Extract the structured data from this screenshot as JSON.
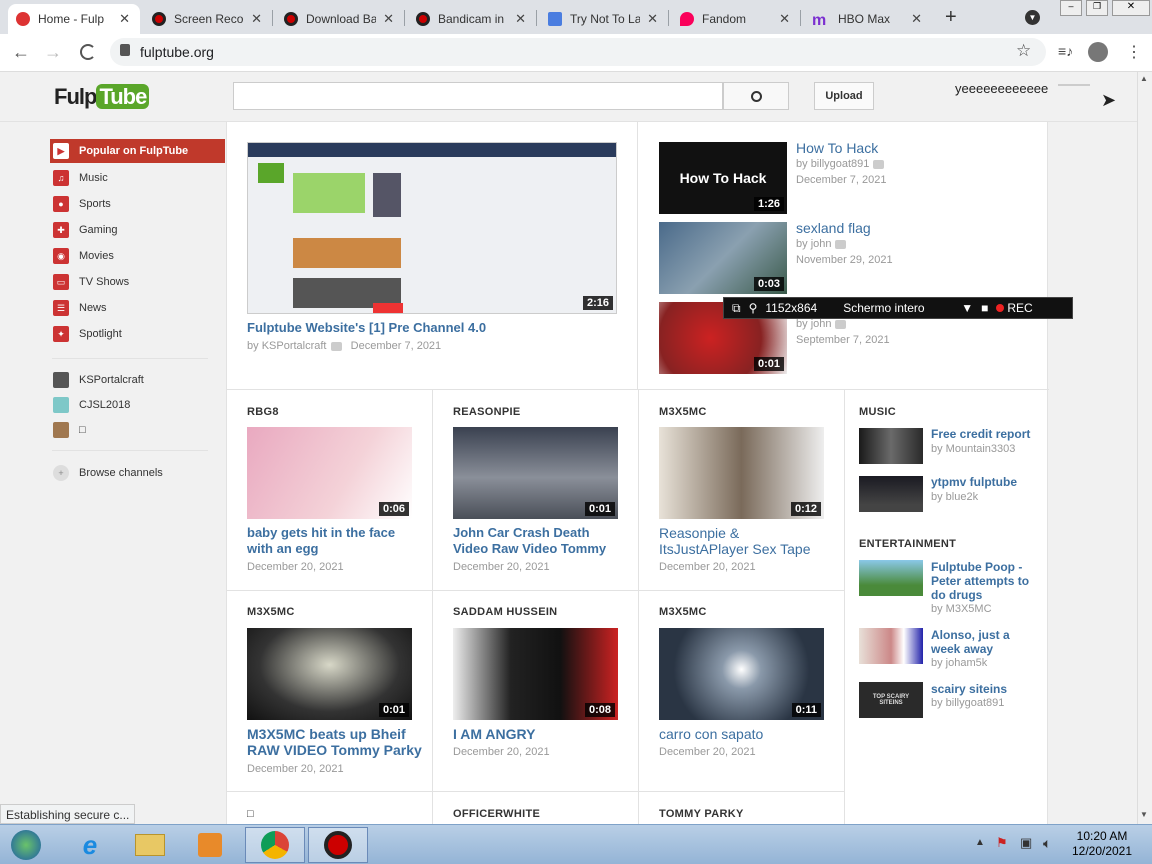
{
  "browser": {
    "tabs": [
      {
        "title": "Home - FulpTube",
        "active": true,
        "favicon_color": "#d33"
      },
      {
        "title": "Screen Recorder",
        "favicon_color": "#c00"
      },
      {
        "title": "Download Bandicam",
        "favicon_color": "#c00"
      },
      {
        "title": "Bandicam in",
        "favicon_color": "#c00"
      },
      {
        "title": "Try Not To Laugh",
        "favicon_color": "#4a7de0"
      },
      {
        "title": "Fandom",
        "favicon_color": "#fa005a"
      },
      {
        "title": "HBO Max",
        "favicon_color": "#7b2fd0"
      }
    ],
    "url": "fulptube.org",
    "status": "Establishing secure c..."
  },
  "site": {
    "logo_prefix": "Fulp",
    "logo_suffix": "Tube",
    "search_placeholder": "",
    "upload_label": "Upload",
    "username": "yeeeeeeeeeeee",
    "sidebar": {
      "categories": [
        {
          "label": "Popular on FulpTube",
          "icon": "youtube-icon",
          "active": true
        },
        {
          "label": "Music",
          "icon": "headphones-icon"
        },
        {
          "label": "Sports",
          "icon": "ball-icon"
        },
        {
          "label": "Gaming",
          "icon": "gamepad-icon"
        },
        {
          "label": "Movies",
          "icon": "film-icon"
        },
        {
          "label": "TV Shows",
          "icon": "tv-icon"
        },
        {
          "label": "News",
          "icon": "newspaper-icon"
        },
        {
          "label": "Spotlight",
          "icon": "spotlight-icon"
        }
      ],
      "subscriptions": [
        {
          "label": "KSPortalcraft"
        },
        {
          "label": "CJSL2018"
        },
        {
          "label": "□"
        }
      ],
      "browse_label": "Browse channels"
    },
    "featured": {
      "title": "Fulptube Website's [1] Pre Channel 4.0",
      "author": "KSPortalcraft",
      "date": "December 7, 2021",
      "duration": "2:16"
    },
    "side_videos": [
      {
        "title": "How To Hack",
        "author": "billygoat891",
        "date": "December 7, 2021",
        "duration": "1:26",
        "thumb_text": "How To Hack"
      },
      {
        "title": "sexland flag",
        "author": "john",
        "date": "November 29, 2021",
        "duration": "0:03"
      },
      {
        "title": "",
        "author": "john",
        "date": "September 7, 2021",
        "duration": "0:01"
      }
    ],
    "rows": [
      [
        {
          "channel": "RBG8",
          "title": "baby gets hit in the face with an egg",
          "date": "December 20, 2021",
          "duration": "0:06"
        },
        {
          "channel": "REASONPIE",
          "title": "John Car Crash Death Video Raw Video Tommy",
          "date": "December 20, 2021",
          "duration": "0:01"
        },
        {
          "channel": "M3X5MC",
          "title": "Reasonpie & ItsJustAPlayer Sex Tape",
          "date": "December 20, 2021",
          "duration": "0:12"
        }
      ],
      [
        {
          "channel": "M3X5MC",
          "title": "M3X5MC beats up Bheif RAW VIDEO Tommy Parky",
          "date": "December 20, 2021",
          "duration": "0:01"
        },
        {
          "channel": "SADDAM HUSSEIN",
          "title": "I AM ANGRY",
          "date": "December 20, 2021",
          "duration": "0:08"
        },
        {
          "channel": "M3X5MC",
          "title": "carro con sapato",
          "date": "December 20, 2021",
          "duration": "0:11"
        }
      ],
      [
        {
          "channel": "□"
        },
        {
          "channel": "OFFICERWHITE"
        },
        {
          "channel": "TOMMY PARKY"
        }
      ]
    ],
    "music": {
      "heading": "MUSIC",
      "items": [
        {
          "title": "Free credit report",
          "author": "by Mountain3303"
        },
        {
          "title": "ytpmv fulptube",
          "author": "by blue2k"
        }
      ]
    },
    "entertainment": {
      "heading": "ENTERTAINMENT",
      "items": [
        {
          "title": "Fulptube Poop - Peter attempts to do drugs",
          "author": "by M3X5MC"
        },
        {
          "title": "Alonso, just a week away",
          "author": "by joham5k"
        },
        {
          "title": "scairy siteins",
          "author": "by billygoat891",
          "thumb_text": "TOP SCAIRY SITEINS"
        }
      ]
    }
  },
  "recorder": {
    "resolution": "1152x864",
    "mode": "Schermo intero",
    "rec": "REC"
  },
  "taskbar": {
    "time": "10:20 AM",
    "date": "12/20/2021"
  }
}
